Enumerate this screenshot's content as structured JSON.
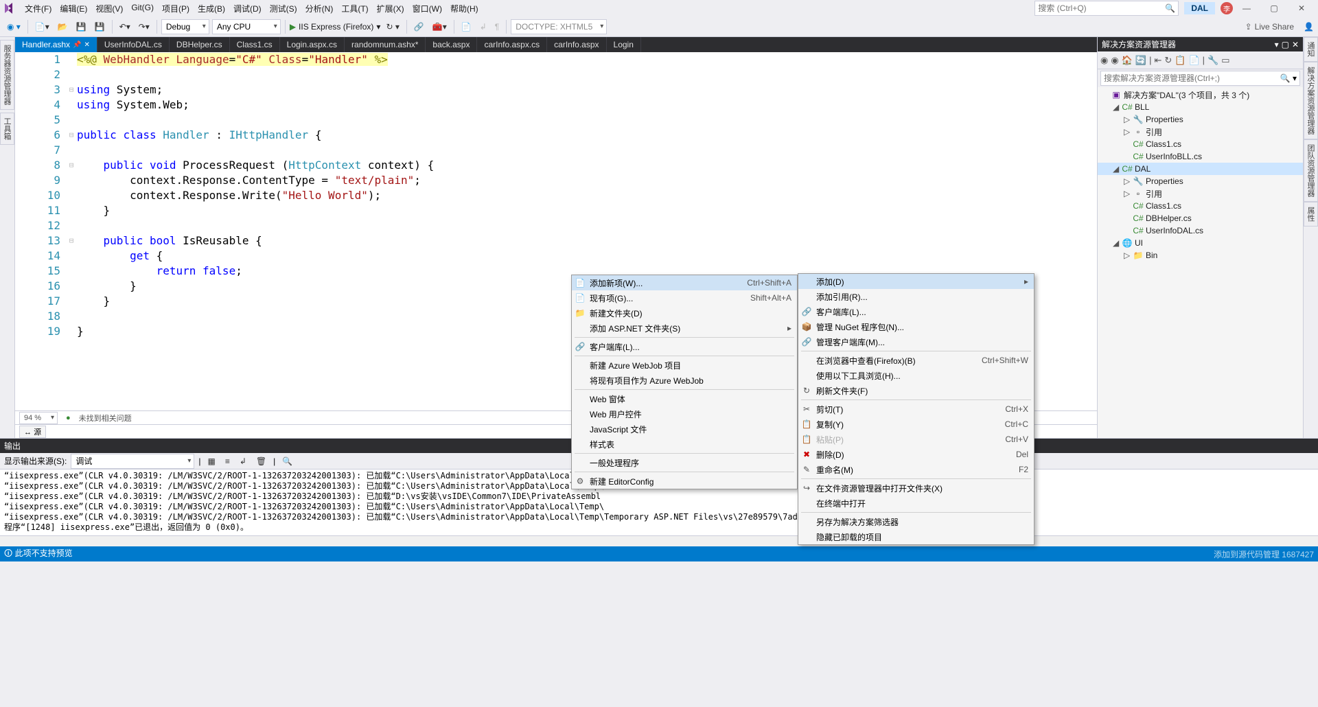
{
  "menubar": {
    "items": [
      "文件(F)",
      "编辑(E)",
      "视图(V)",
      "Git(G)",
      "项目(P)",
      "生成(B)",
      "调试(D)",
      "测试(S)",
      "分析(N)",
      "工具(T)",
      "扩展(X)",
      "窗口(W)",
      "帮助(H)"
    ],
    "search_placeholder": "搜索 (Ctrl+Q)",
    "dal_label": "DAL"
  },
  "toolbar": {
    "config": "Debug",
    "platform": "Any CPU",
    "run_label": "IIS Express (Firefox)",
    "doctype": "DOCTYPE: XHTML5",
    "liveshare": "Live Share"
  },
  "tabs": [
    "Handler.ashx",
    "UserInfoDAL.cs",
    "DBHelper.cs",
    "Class1.cs",
    "Login.aspx.cs",
    "randomnum.ashx*",
    "back.aspx",
    "carInfo.aspx.cs",
    "carInfo.aspx",
    "Login"
  ],
  "code_lines": [
    {
      "n": "1",
      "html": "<span class='yellow-bg'><span class='dir'>&lt;%@</span> <span class='dir-brown'>WebHandler</span> <span class='dir-brown'>Language</span>=<span class='str'>\"C#\"</span> <span class='dir-brown'>Class</span>=<span class='str'>\"Handler\"</span> <span class='dir'>%&gt;</span></span>"
    },
    {
      "n": "2",
      "html": ""
    },
    {
      "n": "3",
      "html": "<span class='kw'>using</span> System;"
    },
    {
      "n": "4",
      "html": "<span class='kw'>using</span> System.Web;"
    },
    {
      "n": "5",
      "html": ""
    },
    {
      "n": "6",
      "html": "<span class='kw'>public</span> <span class='kw'>class</span> <span class='type'>Handler</span> : <span class='type'>IHttpHandler</span> {"
    },
    {
      "n": "7",
      "html": ""
    },
    {
      "n": "8",
      "html": "    <span class='kw'>public</span> <span class='kw'>void</span> ProcessRequest (<span class='type'>HttpContext</span> context) {"
    },
    {
      "n": "9",
      "html": "        context.Response.ContentType = <span class='str'>\"text/plain\"</span>;"
    },
    {
      "n": "10",
      "html": "        context.Response.Write(<span class='str'>\"Hello World\"</span>);"
    },
    {
      "n": "11",
      "html": "    }"
    },
    {
      "n": "12",
      "html": ""
    },
    {
      "n": "13",
      "html": "    <span class='kw'>public</span> <span class='kw'>bool</span> IsReusable {"
    },
    {
      "n": "14",
      "html": "        <span class='kw'>get</span> {"
    },
    {
      "n": "15",
      "html": "            <span class='kw'>return</span> <span class='kw'>false</span>;"
    },
    {
      "n": "16",
      "html": "        }"
    },
    {
      "n": "17",
      "html": "    }"
    },
    {
      "n": "18",
      "html": ""
    },
    {
      "n": "19",
      "html": "}"
    }
  ],
  "zoom": "94 %",
  "issues": "未找到相关问题",
  "source_tab": "源",
  "solution_explorer": {
    "title": "解决方案资源管理器",
    "search_placeholder": "搜索解决方案资源管理器(Ctrl+;)",
    "root": "解决方案\"DAL\"(3 个项目，共 3 个)",
    "nodes": [
      {
        "depth": 1,
        "caret": "◢",
        "ico": "cs-ico",
        "glyph": "C#",
        "label": "BLL"
      },
      {
        "depth": 2,
        "caret": "▷",
        "ico": "wrench",
        "glyph": "🔧",
        "label": "Properties"
      },
      {
        "depth": 2,
        "caret": "▷",
        "ico": "",
        "glyph": "▫",
        "label": "引用"
      },
      {
        "depth": 2,
        "caret": "",
        "ico": "cs-ico",
        "glyph": "C#",
        "label": "Class1.cs"
      },
      {
        "depth": 2,
        "caret": "",
        "ico": "cs-ico",
        "glyph": "C#",
        "label": "UserInfoBLL.cs"
      },
      {
        "depth": 1,
        "caret": "◢",
        "ico": "cs-ico",
        "glyph": "C#",
        "label": "DAL",
        "sel": true
      },
      {
        "depth": 2,
        "caret": "▷",
        "ico": "wrench",
        "glyph": "🔧",
        "label": "Properties"
      },
      {
        "depth": 2,
        "caret": "▷",
        "ico": "",
        "glyph": "▫",
        "label": "引用"
      },
      {
        "depth": 2,
        "caret": "",
        "ico": "cs-ico",
        "glyph": "C#",
        "label": "Class1.cs"
      },
      {
        "depth": 2,
        "caret": "",
        "ico": "cs-ico",
        "glyph": "C#",
        "label": "DBHelper.cs"
      },
      {
        "depth": 2,
        "caret": "",
        "ico": "cs-ico",
        "glyph": "C#",
        "label": "UserInfoDAL.cs"
      },
      {
        "depth": 1,
        "caret": "◢",
        "ico": "",
        "glyph": "🌐",
        "label": "UI"
      },
      {
        "depth": 2,
        "caret": "▷",
        "ico": "fld-ico",
        "glyph": "📁",
        "label": "Bin"
      }
    ]
  },
  "right_rails": [
    "通知",
    "解决方案资源管理器",
    "团队资源管理器",
    "属性"
  ],
  "left_rails": [
    "服务器资源管理器",
    "工具箱"
  ],
  "output": {
    "title": "输出",
    "from_label": "显示输出来源(S):",
    "from_value": "调试",
    "lines": [
      "“iisexpress.exe”(CLR v4.0.30319: /LM/W3SVC/2/ROOT-1-132637203242001303): 已加载“C:\\Users\\Administrator\\AppData\\Local\\Temp\\",
      "“iisexpress.exe”(CLR v4.0.30319: /LM/W3SVC/2/ROOT-1-132637203242001303): 已加载“C:\\Users\\Administrator\\AppData\\Local\\Temp\\",
      "“iisexpress.exe”(CLR v4.0.30319: /LM/W3SVC/2/ROOT-1-132637203242001303): 已加载“D:\\vs安装\\vsIDE\\Common7\\IDE\\PrivateAssembl",
      "“iisexpress.exe”(CLR v4.0.30319: /LM/W3SVC/2/ROOT-1-132637203242001303): 已加载“C:\\Users\\Administrator\\AppData\\Local\\Temp\\",
      "“iisexpress.exe”(CLR v4.0.30319: /LM/W3SVC/2/ROOT-1-132637203242001303): 已加载“C:\\Users\\Administrator\\AppData\\Local\\Temp\\Temporary ASP.NET Files\\vs\\27e89579\\7ad87517\\App_Web_",
      "程序“[1248] iisexpress.exe”已退出，返回值为 0 (0x0)。"
    ]
  },
  "statusbar": {
    "text": "此项不支持预览",
    "watermark": "添加到源代码管理  1687427"
  },
  "ctx_add": {
    "items": [
      {
        "icon": "📄",
        "label": "添加新项(W)...",
        "shortcut": "Ctrl+Shift+A",
        "hl": true
      },
      {
        "icon": "📄",
        "label": "现有项(G)...",
        "shortcut": "Shift+Alt+A"
      },
      {
        "icon": "📁",
        "label": "新建文件夹(D)"
      },
      {
        "label": "添加 ASP.NET 文件夹(S)",
        "arrow": true
      },
      {
        "sep": true
      },
      {
        "icon": "🔗",
        "label": "客户端库(L)..."
      },
      {
        "sep": true
      },
      {
        "label": "新建 Azure WebJob 项目"
      },
      {
        "label": "将现有项目作为 Azure WebJob"
      },
      {
        "sep": true
      },
      {
        "label": "Web 窗体"
      },
      {
        "label": "Web 用户控件"
      },
      {
        "label": "JavaScript 文件"
      },
      {
        "label": "样式表"
      },
      {
        "sep": true
      },
      {
        "label": "一般处理程序"
      },
      {
        "sep": true
      },
      {
        "icon": "⚙",
        "label": "新建 EditorConfig"
      }
    ]
  },
  "ctx_main": {
    "items": [
      {
        "label": "添加(D)",
        "arrow": true,
        "hl": true
      },
      {
        "label": "添加引用(R)..."
      },
      {
        "icon": "🔗",
        "label": "客户端库(L)..."
      },
      {
        "icon": "📦",
        "label": "管理 NuGet 程序包(N)..."
      },
      {
        "icon": "🔗",
        "label": "管理客户端库(M)..."
      },
      {
        "sep": true
      },
      {
        "label": "在浏览器中查看(Firefox)(B)",
        "shortcut": "Ctrl+Shift+W"
      },
      {
        "label": "使用以下工具浏览(H)..."
      },
      {
        "icon": "↻",
        "label": "刷新文件夹(F)"
      },
      {
        "sep": true
      },
      {
        "icon": "✂",
        "label": "剪切(T)",
        "shortcut": "Ctrl+X"
      },
      {
        "icon": "📋",
        "label": "复制(Y)",
        "shortcut": "Ctrl+C"
      },
      {
        "icon": "📋",
        "label": "粘贴(P)",
        "shortcut": "Ctrl+V",
        "disabled": true
      },
      {
        "icon": "✖",
        "label": "删除(D)",
        "shortcut": "Del",
        "iconColor": "#c00"
      },
      {
        "icon": "✎",
        "label": "重命名(M)",
        "shortcut": "F2"
      },
      {
        "sep": true
      },
      {
        "icon": "↪",
        "label": "在文件资源管理器中打开文件夹(X)"
      },
      {
        "label": "在终端中打开"
      },
      {
        "sep": true
      },
      {
        "label": "另存为解决方案筛选器"
      },
      {
        "label": "隐藏已卸载的项目"
      }
    ]
  }
}
